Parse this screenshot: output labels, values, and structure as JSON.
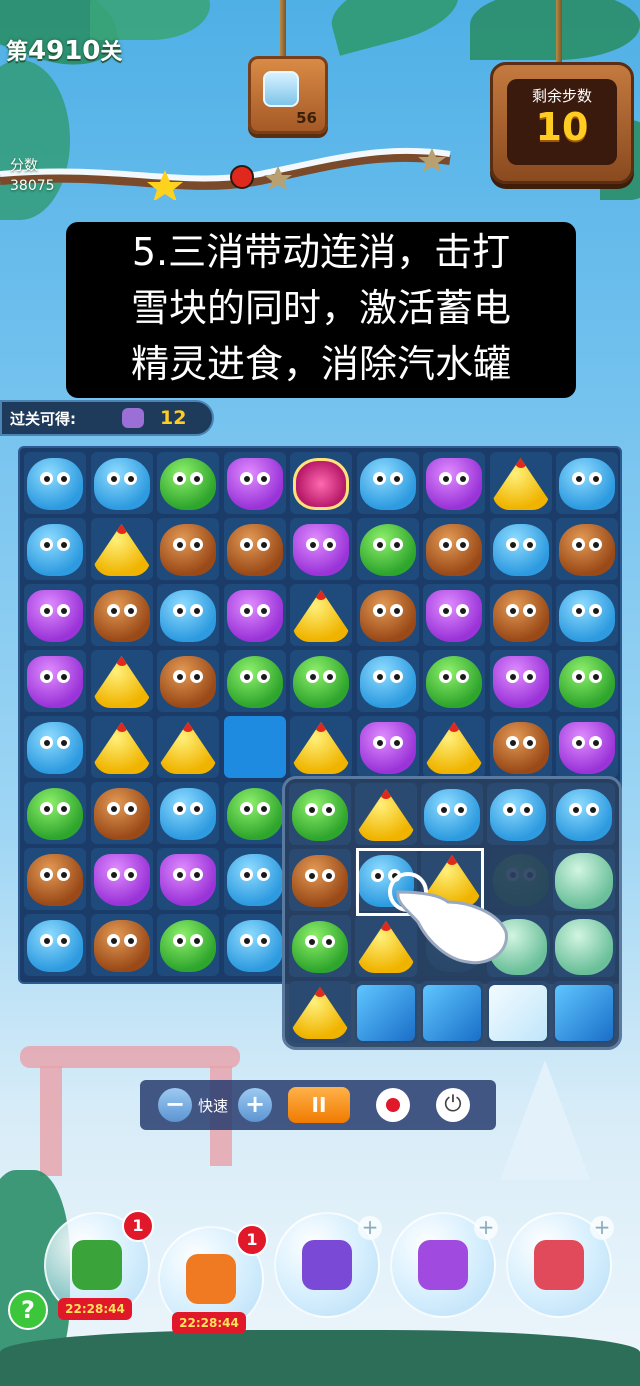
{
  "hud": {
    "level_prefix": "第",
    "level_number": "4910",
    "level_suffix": "关",
    "score_label": "分数",
    "score_value": "38075",
    "target_count": "56",
    "moves_label": "剩余步数",
    "moves_value": "10"
  },
  "caption": {
    "lines": [
      "5.三消带动连消，击打",
      "雪块的同时，激活蓄电",
      "精灵进食，消除汽水罐"
    ]
  },
  "reward": {
    "label": "过关可得:",
    "count": "12"
  },
  "board": {
    "rows": [
      [
        "blue",
        "blue",
        "green",
        "purple",
        "special",
        "blue",
        "purple",
        "yellow",
        "blue"
      ],
      [
        "blue",
        "yellow",
        "brown",
        "brown",
        "purple",
        "green",
        "brown",
        "blue",
        "brown"
      ],
      [
        "purple",
        "brown",
        "blue",
        "purple",
        "yellow",
        "brown",
        "purple",
        "brown",
        "blue"
      ],
      [
        "purple",
        "yellow",
        "brown",
        "green",
        "green",
        "blue",
        "green",
        "purple",
        "green"
      ],
      [
        "blue",
        "yellow",
        "yellow",
        "empty",
        "yellow",
        "purple",
        "yellow",
        "brown",
        "purple"
      ],
      [
        "green",
        "brown",
        "blue",
        "green",
        "green",
        "yellow",
        "blue",
        "blue",
        "blue"
      ],
      [
        "brown",
        "purple",
        "purple",
        "blue",
        "brown",
        "blue",
        "yellow",
        "green",
        "can"
      ],
      [
        "blue",
        "brown",
        "green",
        "blue",
        "green",
        "yellow",
        "blue",
        "can",
        "can"
      ]
    ]
  },
  "zoom": {
    "rows": [
      [
        "green",
        "yellow",
        "blue",
        "blue",
        "blue"
      ],
      [
        "brown",
        "blue",
        "yellow",
        "none",
        "can"
      ],
      [
        "green",
        "yellow",
        "none",
        "can",
        "can"
      ],
      [
        "yellow",
        "ice",
        "ice",
        "icewhite",
        "ice"
      ]
    ]
  },
  "controls": {
    "minus": "−",
    "speed_label": "快速",
    "plus": "+",
    "pause": "II",
    "power": "⏻"
  },
  "boosters": [
    {
      "name": "shuffle",
      "badge": "1",
      "timer": "22:28:44",
      "color": "#3aa43a"
    },
    {
      "name": "clock",
      "badge": "1",
      "timer": "22:28:44",
      "color": "#f07a22"
    },
    {
      "name": "swap",
      "badge": "",
      "timer": "",
      "color": "#7a4ad6"
    },
    {
      "name": "rocket-purple",
      "badge": "",
      "timer": "",
      "color": "#a04ae0"
    },
    {
      "name": "rocket-red",
      "badge": "",
      "timer": "",
      "color": "#e04a5a"
    }
  ],
  "help": "?"
}
